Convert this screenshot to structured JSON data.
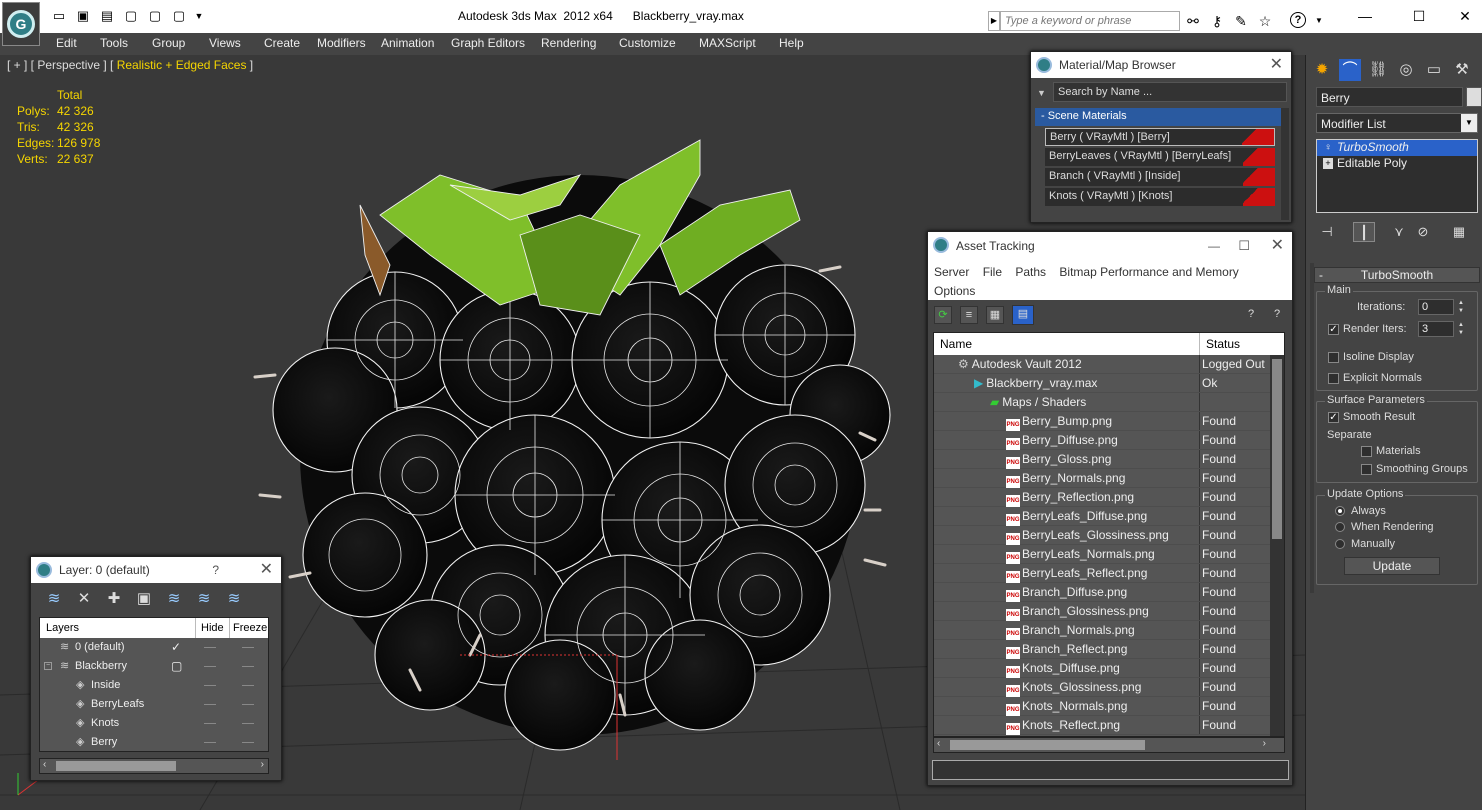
{
  "titlebar": {
    "app_title": "Autodesk 3ds Max  2012 x64",
    "file_title": "Blackberry_vray.max",
    "search_placeholder": "Type a keyword or phrase",
    "help_label": "?",
    "logo_label": "G"
  },
  "menu": [
    "Edit",
    "Tools",
    "Group",
    "Views",
    "Create",
    "Modifiers",
    "Animation",
    "Graph Editors",
    "Rendering",
    "Customize",
    "MAXScript",
    "Help"
  ],
  "viewport": {
    "label_prefix": "[ + ] [ Perspective ] [ ",
    "label_mode": "Realistic + Edged Faces",
    "label_suffix": " ]",
    "stats": {
      "header": "Total",
      "rows": [
        {
          "label": "Polys:",
          "value": "42 326"
        },
        {
          "label": "Tris:",
          "value": "42 326"
        },
        {
          "label": "Edges:",
          "value": "126 978"
        },
        {
          "label": "Verts:",
          "value": "22 637"
        }
      ]
    }
  },
  "material_browser": {
    "title": "Material/Map Browser",
    "search_placeholder": "Search by Name ...",
    "section": "- Scene Materials",
    "materials": [
      "Berry  ( VRayMtl )  [Berry]",
      "BerryLeaves  ( VRayMtl )  [BerryLeafs]",
      "Branch  ( VRayMtl )  [Inside]",
      "Knots  ( VRayMtl )  [Knots]"
    ]
  },
  "asset_tracking": {
    "title": "Asset Tracking",
    "menu": [
      "Server",
      "File",
      "Paths",
      "Bitmap Performance and Memory",
      "Options"
    ],
    "columns": {
      "name": "Name",
      "status": "Status"
    },
    "rows": [
      {
        "name": "Autodesk Vault 2012",
        "status": "Logged Out",
        "indent": 0,
        "icon": "vault"
      },
      {
        "name": "Blackberry_vray.max",
        "status": "Ok",
        "indent": 1,
        "icon": "max"
      },
      {
        "name": "Maps / Shaders",
        "status": "",
        "indent": 2,
        "icon": "maps"
      },
      {
        "name": "Berry_Bump.png",
        "status": "Found",
        "indent": 3,
        "icon": "png"
      },
      {
        "name": "Berry_Diffuse.png",
        "status": "Found",
        "indent": 3,
        "icon": "png"
      },
      {
        "name": "Berry_Gloss.png",
        "status": "Found",
        "indent": 3,
        "icon": "png"
      },
      {
        "name": "Berry_Normals.png",
        "status": "Found",
        "indent": 3,
        "icon": "png"
      },
      {
        "name": "Berry_Reflection.png",
        "status": "Found",
        "indent": 3,
        "icon": "png"
      },
      {
        "name": "BerryLeafs_Diffuse.png",
        "status": "Found",
        "indent": 3,
        "icon": "png"
      },
      {
        "name": "BerryLeafs_Glossiness.png",
        "status": "Found",
        "indent": 3,
        "icon": "png"
      },
      {
        "name": "BerryLeafs_Normals.png",
        "status": "Found",
        "indent": 3,
        "icon": "png"
      },
      {
        "name": "BerryLeafs_Reflect.png",
        "status": "Found",
        "indent": 3,
        "icon": "png"
      },
      {
        "name": "Branch_Diffuse.png",
        "status": "Found",
        "indent": 3,
        "icon": "png"
      },
      {
        "name": "Branch_Glossiness.png",
        "status": "Found",
        "indent": 3,
        "icon": "png"
      },
      {
        "name": "Branch_Normals.png",
        "status": "Found",
        "indent": 3,
        "icon": "png"
      },
      {
        "name": "Branch_Reflect.png",
        "status": "Found",
        "indent": 3,
        "icon": "png"
      },
      {
        "name": "Knots_Diffuse.png",
        "status": "Found",
        "indent": 3,
        "icon": "png"
      },
      {
        "name": "Knots_Glossiness.png",
        "status": "Found",
        "indent": 3,
        "icon": "png"
      },
      {
        "name": "Knots_Normals.png",
        "status": "Found",
        "indent": 3,
        "icon": "png"
      },
      {
        "name": "Knots_Reflect.png",
        "status": "Found",
        "indent": 3,
        "icon": "png"
      }
    ]
  },
  "layer_window": {
    "title": "Layer: 0 (default)",
    "help": "?",
    "columns": {
      "layers": "Layers",
      "hide": "Hide",
      "freeze": "Freeze"
    },
    "rows": [
      {
        "name": "0 (default)",
        "indent": 0,
        "check": "✓"
      },
      {
        "name": "Blackberry",
        "indent": 0,
        "check": "▢"
      },
      {
        "name": "Inside",
        "indent": 1,
        "check": ""
      },
      {
        "name": "BerryLeafs",
        "indent": 1,
        "check": ""
      },
      {
        "name": "Knots",
        "indent": 1,
        "check": ""
      },
      {
        "name": "Berry",
        "indent": 1,
        "check": ""
      }
    ]
  },
  "command_panel": {
    "object_name": "Berry",
    "modifier_list": "Modifier List",
    "stack": [
      "TurboSmooth",
      "Editable Poly"
    ],
    "rollout_title": "TurboSmooth",
    "main_group": "Main",
    "iterations_label": "Iterations:",
    "iterations_value": "0",
    "render_iters_label": "Render Iters:",
    "render_iters_value": "3",
    "isoline_label": "Isoline Display",
    "explicit_normals_label": "Explicit Normals",
    "surface_group": "Surface Parameters",
    "smooth_result_label": "Smooth Result",
    "separate_label": "Separate",
    "materials_label": "Materials",
    "smoothing_groups_label": "Smoothing Groups",
    "update_group": "Update Options",
    "always_label": "Always",
    "when_rendering_label": "When Rendering",
    "manually_label": "Manually",
    "update_button": "Update"
  },
  "colors": {
    "stats_yellow": "#f5d500",
    "selection_blue": "#2a62c9",
    "swatch_red": "#cc1010",
    "leaf_green": "#7fbf2a"
  }
}
